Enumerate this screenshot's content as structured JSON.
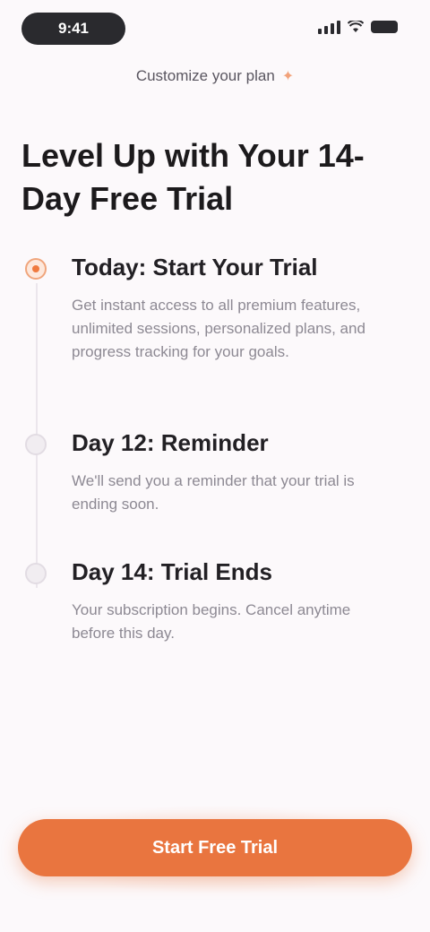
{
  "status_bar": {
    "time": "9:41"
  },
  "header": {
    "label": "Customize your plan"
  },
  "title": "Level Up with Your 14-Day Free Trial",
  "steps": [
    {
      "title": "Today: Start Your Trial",
      "description": "Get instant access to all premium features, unlimited sessions, personalized plans, and progress tracking for your goals."
    },
    {
      "title": "Day 12: Reminder",
      "description": "We'll send you a reminder that your trial is ending soon."
    },
    {
      "title": "Day 14: Trial Ends",
      "description": "Your subscription begins. Cancel anytime before this day."
    }
  ],
  "cta": {
    "label": "Start Free Trial"
  },
  "colors": {
    "accent": "#e9753f",
    "background": "#fcf9fb"
  }
}
